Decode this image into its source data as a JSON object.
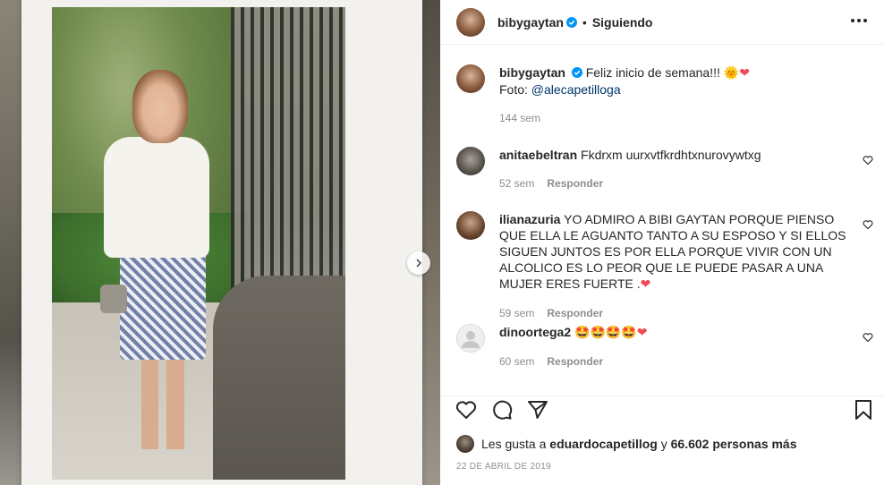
{
  "colors": {
    "accent": "#0095f6",
    "text": "#262626",
    "muted": "#8e8e8e",
    "like": "#ed4956",
    "link": "#00376b"
  },
  "header": {
    "username": "bibygaytan",
    "dot": "•",
    "follow_status": "Siguiendo"
  },
  "caption": {
    "username": "bibygaytan",
    "text": "Feliz inicio de semana!!!",
    "photo_prefix": "Foto:",
    "photo_mention": "@alecapetilloga",
    "time": "144 sem"
  },
  "comments": [
    {
      "username": "anitaebeltran",
      "text": "Fkdrxm uurxvtfkrdhtxnurovywtxg",
      "time": "52 sem",
      "reply": "Responder"
    },
    {
      "username": "ilianazuria",
      "text": "YO ADMIRO A BIBI GAYTAN PORQUE PIENSO QUE ELLA LE AGUANTO TANTO A SU ESPOSO Y SI ELLOS SIGUEN JUNTOS ES POR ELLA PORQUE VIVIR CON UN ALCOLICO ES LO PEOR QUE LE PUEDE PASAR A UNA MUJER ERES FUERTE .",
      "time": "59 sem",
      "reply": "Responder"
    },
    {
      "username": "dinoortega2",
      "text": "",
      "time": "60 sem",
      "reply": "Responder"
    }
  ],
  "likes": {
    "prefix": "Les gusta a",
    "user": "eduardocapetillog",
    "middle": "y",
    "count": "66.602 personas más"
  },
  "date": "22 DE ABRIL DE 2019",
  "icons": [
    "more-icon",
    "verified-badge-icon",
    "sun-emoji",
    "heart-emoji",
    "heart-outline-icon",
    "comment-icon",
    "share-icon",
    "bookmark-icon",
    "chevron-right-icon",
    "star-struck-emoji"
  ]
}
